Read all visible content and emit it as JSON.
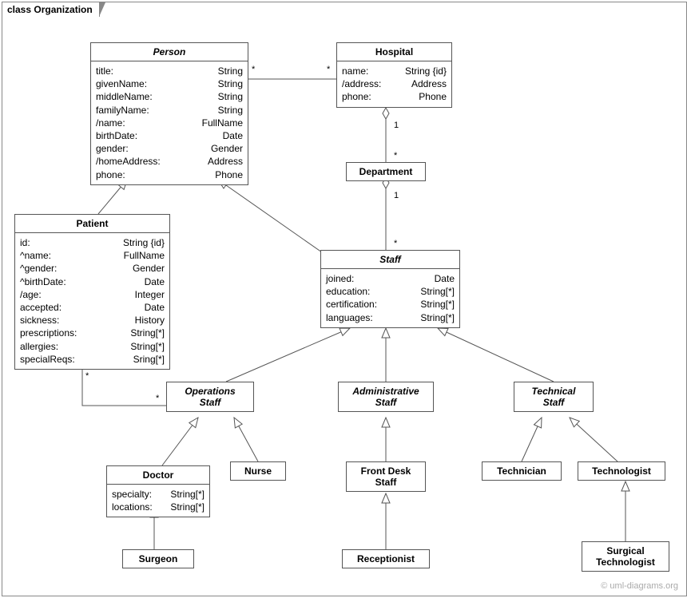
{
  "diagram_title": "class Organization",
  "watermark": "© uml-diagrams.org",
  "classes": {
    "person": {
      "name": "Person",
      "attrs": [
        {
          "n": "title:",
          "t": "String"
        },
        {
          "n": "givenName:",
          "t": "String"
        },
        {
          "n": "middleName:",
          "t": "String"
        },
        {
          "n": "familyName:",
          "t": "String"
        },
        {
          "n": "/name:",
          "t": "FullName"
        },
        {
          "n": "birthDate:",
          "t": "Date"
        },
        {
          "n": "gender:",
          "t": "Gender"
        },
        {
          "n": "/homeAddress:",
          "t": "Address"
        },
        {
          "n": "phone:",
          "t": "Phone"
        }
      ]
    },
    "hospital": {
      "name": "Hospital",
      "attrs": [
        {
          "n": "name:",
          "t": "String {id}"
        },
        {
          "n": "/address:",
          "t": "Address"
        },
        {
          "n": "phone:",
          "t": "Phone"
        }
      ]
    },
    "department": {
      "name": "Department",
      "attrs": []
    },
    "patient": {
      "name": "Patient",
      "attrs": [
        {
          "n": "id:",
          "t": "String {id}"
        },
        {
          "n": "^name:",
          "t": "FullName"
        },
        {
          "n": "^gender:",
          "t": "Gender"
        },
        {
          "n": "^birthDate:",
          "t": "Date"
        },
        {
          "n": "/age:",
          "t": "Integer"
        },
        {
          "n": "accepted:",
          "t": "Date"
        },
        {
          "n": "sickness:",
          "t": "History"
        },
        {
          "n": "prescriptions:",
          "t": "String[*]"
        },
        {
          "n": "allergies:",
          "t": "String[*]"
        },
        {
          "n": "specialReqs:",
          "t": "Sring[*]"
        }
      ]
    },
    "staff": {
      "name": "Staff",
      "attrs": [
        {
          "n": "joined:",
          "t": "Date"
        },
        {
          "n": "education:",
          "t": "String[*]"
        },
        {
          "n": "certification:",
          "t": "String[*]"
        },
        {
          "n": "languages:",
          "t": "String[*]"
        }
      ]
    },
    "opstaff": {
      "name": "Operations\nStaff",
      "attrs": []
    },
    "adminstaff": {
      "name": "Administrative\nStaff",
      "attrs": []
    },
    "techstaff": {
      "name": "Technical\nStaff",
      "attrs": []
    },
    "doctor": {
      "name": "Doctor",
      "attrs": [
        {
          "n": "specialty:",
          "t": "String[*]"
        },
        {
          "n": "locations:",
          "t": "String[*]"
        }
      ]
    },
    "nurse": {
      "name": "Nurse",
      "attrs": []
    },
    "frontdesk": {
      "name": "Front Desk\nStaff",
      "attrs": []
    },
    "technician": {
      "name": "Technician",
      "attrs": []
    },
    "technologist": {
      "name": "Technologist",
      "attrs": []
    },
    "surgeon": {
      "name": "Surgeon",
      "attrs": []
    },
    "receptionist": {
      "name": "Receptionist",
      "attrs": []
    },
    "surgtech": {
      "name": "Surgical\nTechnologist",
      "attrs": []
    }
  },
  "multiplicities": {
    "person_hospital_left": "*",
    "person_hospital_right": "*",
    "hospital_dept_top": "1",
    "hospital_dept_bottom": "*",
    "dept_staff_top": "1",
    "dept_staff_bottom": "*",
    "patient_ops_left": "*",
    "patient_ops_right": "*"
  }
}
